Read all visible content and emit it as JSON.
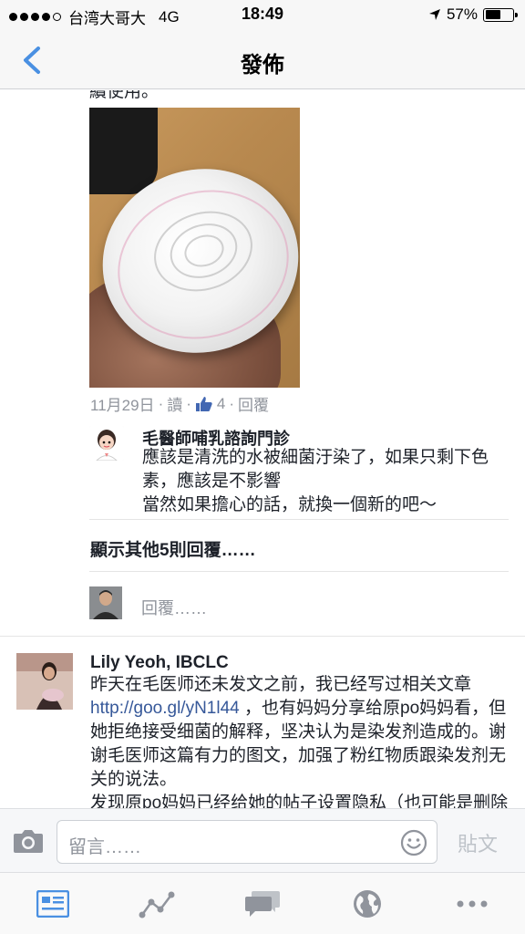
{
  "status_bar": {
    "carrier": "台湾大哥大",
    "network": "4G",
    "time": "18:49",
    "battery_percent": "57%",
    "battery_level": 0.57
  },
  "nav": {
    "title": "發佈",
    "back_icon": "chevron-left-icon"
  },
  "post": {
    "cut_text": "續使用。",
    "photo_icon": "photo"
  },
  "meta": {
    "date": "11月29日",
    "sep1": "·",
    "read": "讀",
    "sep2": "·",
    "like_count": "4",
    "sep3": "·",
    "reply": "回覆"
  },
  "reply": {
    "name": "毛醫師哺乳諮詢門診",
    "lines": [
      "應該是清洗的水被細菌汙染了，如果只剩下色素，應該是不影響",
      "當然如果擔心的話，就換一個新的吧～"
    ]
  },
  "show_more": "顯示其他5則回覆……",
  "reply_placeholder": "回覆……",
  "comment": {
    "name": "Lily Yeoh, IBCLC",
    "text_before_link": "昨天在毛医师还未发文之前，我已经写过相关文章 ",
    "link": "http://goo.gl/yN1l44",
    "text_after_link": " ，也有妈妈分享给原po妈妈看，但她拒绝接受细菌的解释，坚决认为是染发剂造成的。谢谢毛医师这篇有力的图文，加强了粉红物质跟染发剂无关的说法。",
    "text_para2": "发现原po妈妈已经给她的帖子设置隐私（也可能是删除了），其实她的心情应该也是不好受，刚"
  },
  "composer": {
    "placeholder": "留言……",
    "post_label": "貼文"
  },
  "colors": {
    "accent": "#4a90e2",
    "link": "#365899",
    "meta": "#90949c"
  },
  "tabs": [
    {
      "name": "news-feed",
      "icon": "news-feed-icon",
      "active": true
    },
    {
      "name": "activity",
      "icon": "chart-line-icon",
      "active": false
    },
    {
      "name": "messages",
      "icon": "chat-bubbles-icon",
      "active": false
    },
    {
      "name": "globe",
      "icon": "globe-icon",
      "active": false
    },
    {
      "name": "more",
      "icon": "more-dots-icon",
      "active": false
    }
  ]
}
